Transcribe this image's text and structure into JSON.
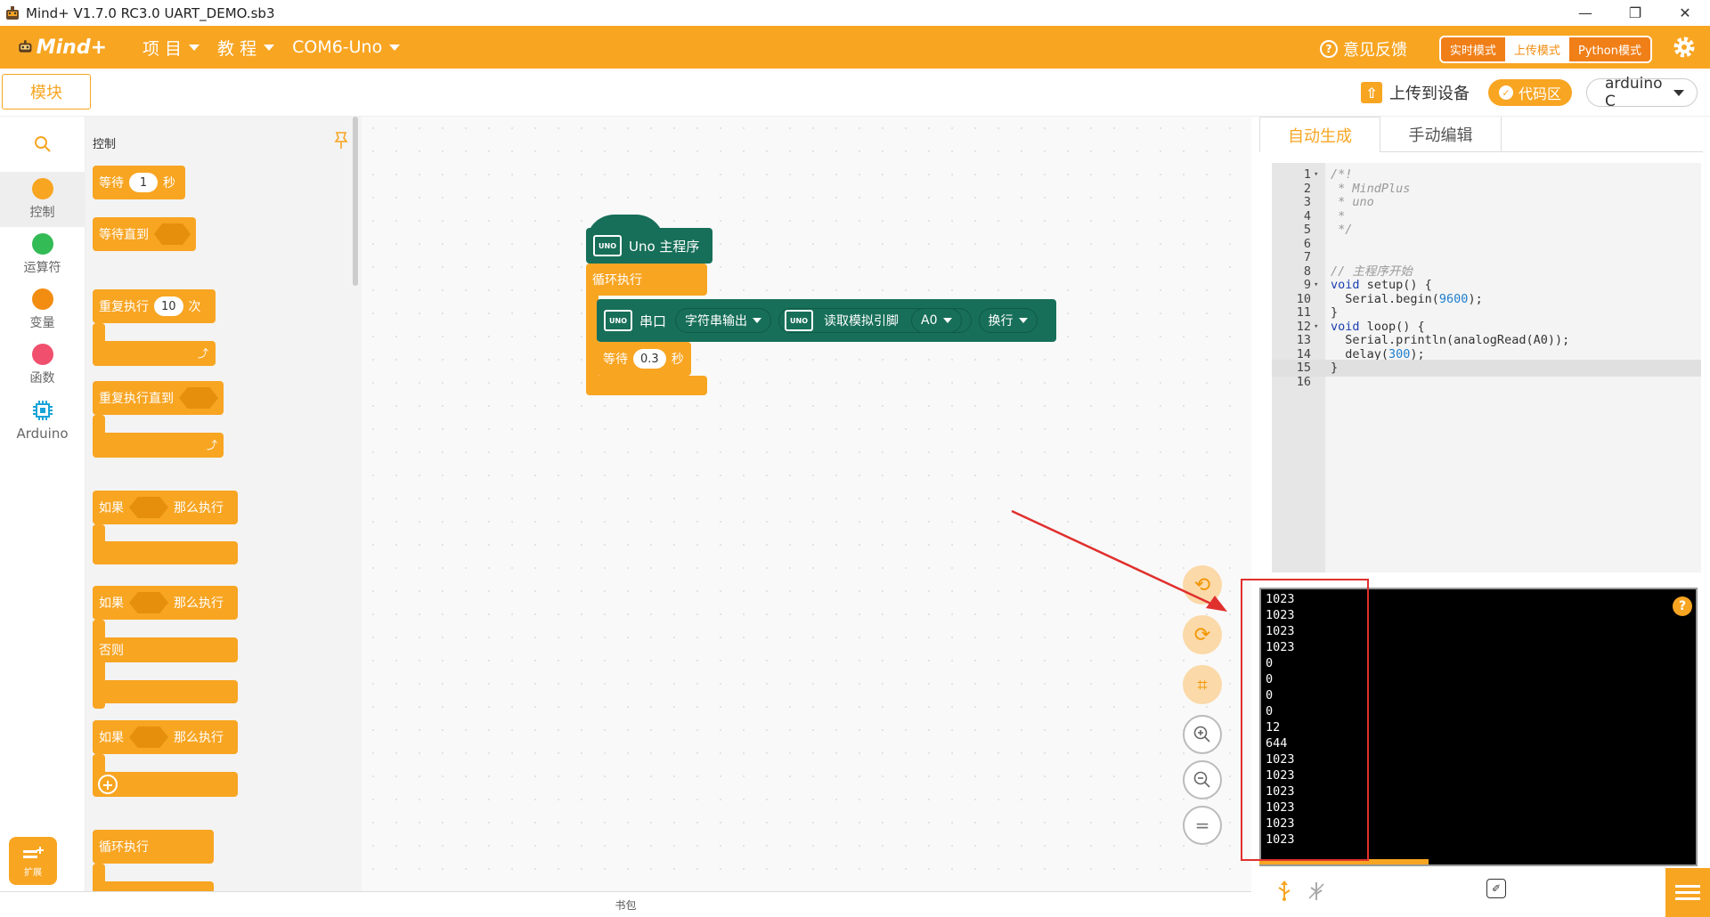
{
  "window": {
    "title": "Mind+ V1.7.0 RC3.0   UART_DEMO.sb3",
    "minimize": "—",
    "maximize": "❐",
    "close": "✕"
  },
  "menubar": {
    "logo_text": "Mind+",
    "project": "项 目",
    "tutorial": "教 程",
    "device": "COM6-Uno",
    "feedback": "意见反馈",
    "modes": [
      "实时模式",
      "上传模式",
      "Python模式"
    ],
    "active_mode": "上传模式"
  },
  "toolbar": {
    "blocks_tab": "模块",
    "upload": "上传到设备",
    "code_area": "代码区",
    "language": "arduino C"
  },
  "categories": [
    {
      "label": "控制",
      "color": "#f8a522"
    },
    {
      "label": "运算符",
      "color": "#33bb55"
    },
    {
      "label": "变量",
      "color": "#f28d12"
    },
    {
      "label": "函数",
      "color": "#f0506e"
    },
    {
      "label": "Arduino",
      "color": "#17a3d8"
    }
  ],
  "extension_label": "扩展",
  "flyout": {
    "title": "控制",
    "wait": "等待",
    "wait_value": "1",
    "seconds": "秒",
    "wait_until": "等待直到",
    "repeat": "重复执行",
    "repeat_value": "10",
    "times": "次",
    "repeat_until": "重复执行直到",
    "if": "如果",
    "then": "那么执行",
    "else": "否则",
    "forever": "循环执行"
  },
  "workspace": {
    "hat_label": "Uno 主程序",
    "forever_label": "循环执行",
    "serial_label": "串口",
    "serial_mode": "字符串输出",
    "read_analog": "读取模拟引脚",
    "pin": "A0",
    "newline": "换行",
    "wait_label": "等待",
    "wait_value": "0.3",
    "seconds": "秒",
    "uno_badge": "UNO"
  },
  "bag_label": "书包",
  "code_tabs": [
    "自动生成",
    "手动编辑"
  ],
  "code_lines": [
    {
      "n": "1",
      "fold": "▾",
      "html": "<span class=\"cm\">/*!</span>"
    },
    {
      "n": "2",
      "fold": "",
      "html": "<span class=\"cm\"> * MindPlus</span>"
    },
    {
      "n": "3",
      "fold": "",
      "html": "<span class=\"cm\"> * uno</span>"
    },
    {
      "n": "4",
      "fold": "",
      "html": "<span class=\"cm\"> *</span>"
    },
    {
      "n": "5",
      "fold": "",
      "html": "<span class=\"cm\"> */</span>"
    },
    {
      "n": "6",
      "fold": "",
      "html": ""
    },
    {
      "n": "7",
      "fold": "",
      "html": ""
    },
    {
      "n": "8",
      "fold": "",
      "html": "<span class=\"cm\">// 主程序开始</span>"
    },
    {
      "n": "9",
      "fold": "▾",
      "html": "<span class=\"kw\">void</span> setup() {"
    },
    {
      "n": "10",
      "fold": "",
      "html": "  Serial.begin(<span class=\"nm\">9600</span>);"
    },
    {
      "n": "11",
      "fold": "",
      "html": "}"
    },
    {
      "n": "12",
      "fold": "▾",
      "html": "<span class=\"kw\">void</span> loop() {"
    },
    {
      "n": "13",
      "fold": "",
      "html": "  Serial.println(analogRead(A0));"
    },
    {
      "n": "14",
      "fold": "",
      "html": "  delay(<span class=\"nm\">300</span>);"
    },
    {
      "n": "15",
      "fold": "",
      "html": "}"
    },
    {
      "n": "16",
      "fold": "",
      "html": ""
    }
  ],
  "serial_output": [
    "1023",
    "1023",
    "1023",
    "1023",
    "0",
    "0",
    "0",
    "0",
    "12",
    "644",
    "1023",
    "1023",
    "1023",
    "1023",
    "1023",
    "1023"
  ],
  "help_icon": "?",
  "colors": {
    "accent": "#f8a522",
    "block_green": "#176f59",
    "annotation_red": "#e0302e"
  }
}
